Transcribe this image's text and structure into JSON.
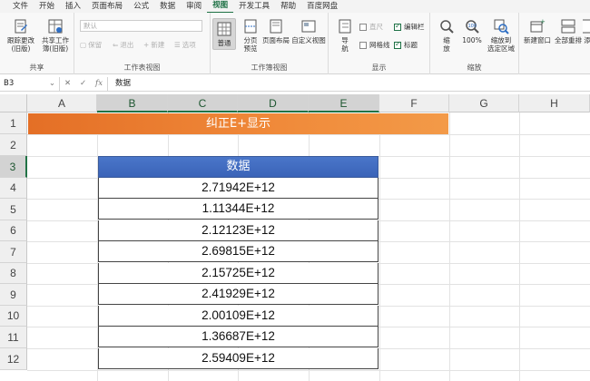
{
  "menu": [
    "文件",
    "开始",
    "插入",
    "页面布局",
    "公式",
    "数据",
    "审阅",
    "视图",
    "开发工具",
    "帮助",
    "百度网盘"
  ],
  "active_menu": "视图",
  "ribbon": {
    "share": {
      "btn1": "跟踪更改\n(旧版)",
      "btn2": "共享工作\n簿(旧版)",
      "label": "共享"
    },
    "sheetview": {
      "select_value": "默认",
      "keep": "保留",
      "exit": "退出",
      "new": "新建",
      "options": "选项",
      "label": "工作表视图"
    },
    "bookview": {
      "normal": "普通",
      "pagebreak": "分页\n预览",
      "pagelayout": "页面布局",
      "custom": "自定义视图",
      "label": "工作簿视图"
    },
    "show": {
      "nav": "导\n航",
      "ruler": "直尺",
      "formulabar": "编辑栏",
      "gridlines": "网格线",
      "headings": "标题",
      "label": "显示"
    },
    "zoom": {
      "zoom": "缩\n放",
      "zoom100": "100%",
      "fit": "缩放到\n选定区域",
      "label": "缩放"
    },
    "window": {
      "newwin": "新建窗口",
      "arrange": "全部重排",
      "add": "添"
    }
  },
  "formula_bar": {
    "name_box": "B3",
    "fx": "fx",
    "content": "数据"
  },
  "columns": [
    "A",
    "B",
    "C",
    "D",
    "E",
    "F",
    "G",
    "H"
  ],
  "rows": [
    "1",
    "2",
    "3",
    "4",
    "5",
    "6",
    "7",
    "8",
    "9",
    "10",
    "11",
    "12"
  ],
  "sheet": {
    "title": "纠正E+显示",
    "header": "数据",
    "values": [
      "2.71942E+12",
      "1.11344E+12",
      "2.12123E+12",
      "2.69815E+12",
      "2.15725E+12",
      "2.41929E+12",
      "2.00109E+12",
      "1.36687E+12",
      "2.59409E+12"
    ]
  },
  "colors": {
    "accent": "#1e7145",
    "title_bg": "#e46f26",
    "header_bg": "#3a63b8"
  }
}
